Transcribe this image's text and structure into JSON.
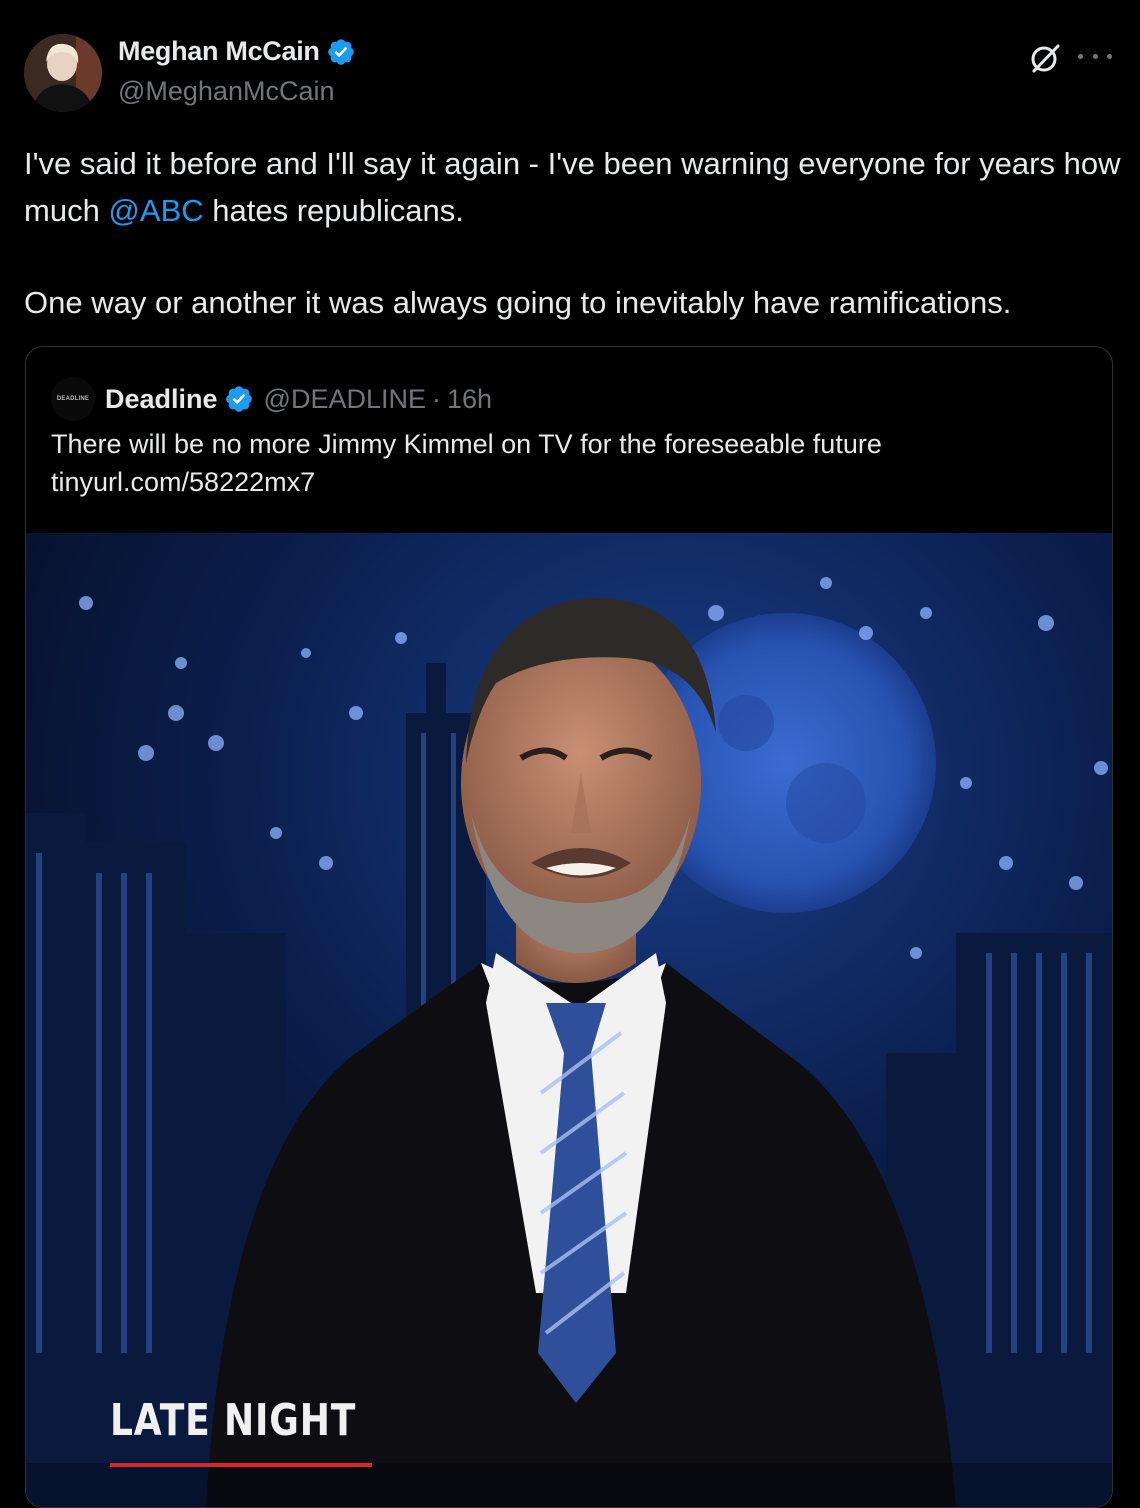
{
  "author": {
    "display_name": "Meghan McCain",
    "handle": "@MeghanMcCain",
    "verified": true
  },
  "post": {
    "line1_before": "I've said it before and I'll say it again - I've been warning everyone for years how much ",
    "mention": "@ABC",
    "line1_after": " hates republicans.",
    "line2": "One way or another it was always going to inevitably have ramifications."
  },
  "quoted": {
    "avatar_text": "DEADLINE",
    "display_name": "Deadline",
    "handle": "@DEADLINE",
    "separator": "·",
    "time": "16h",
    "verified": true,
    "text": "There will be no more Jimmy Kimmel on TV for the foreseeable future",
    "link": "tinyurl.com/58222mx7",
    "media_caption": "LATE NIGHT"
  },
  "icons": {
    "verified": "verified-badge-icon",
    "grok": "grok-icon",
    "more": "more-options-icon"
  },
  "colors": {
    "background": "#000000",
    "text": "#e7e9ea",
    "secondary": "#71767b",
    "accent": "#1d9bf0",
    "border": "#2f3336"
  }
}
